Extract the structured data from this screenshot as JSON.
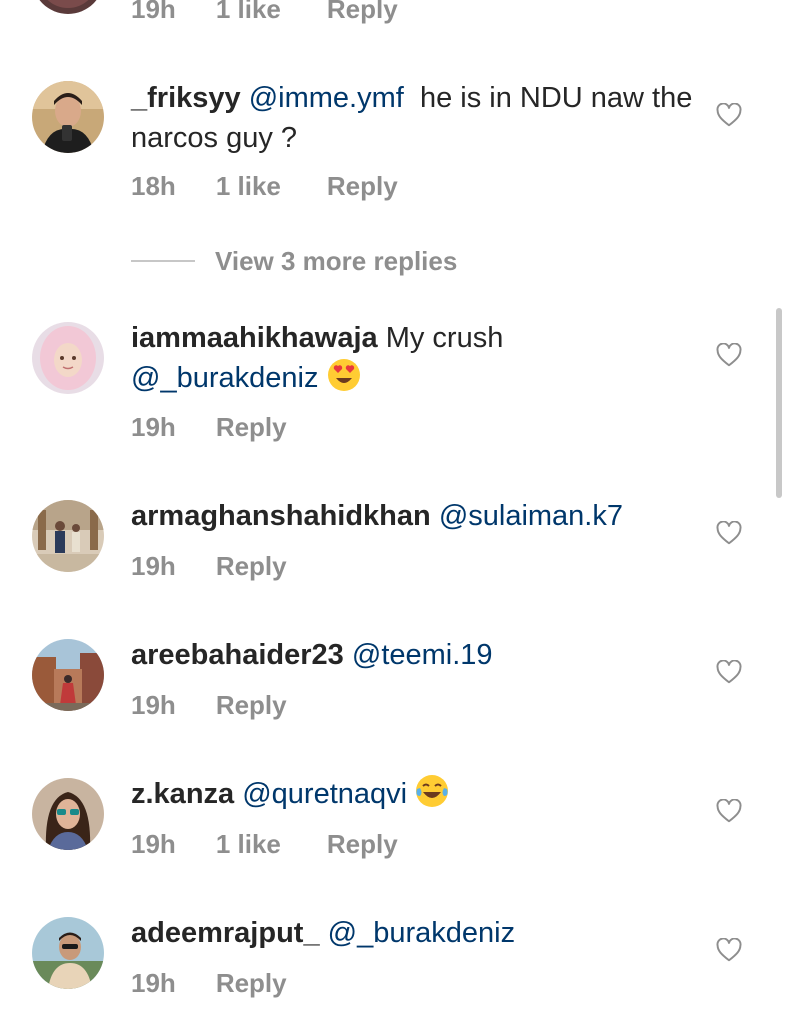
{
  "top_partial": {
    "time": "19h",
    "likes": "1 like",
    "reply": "Reply"
  },
  "comments": [
    {
      "username": "_friksyy",
      "mention": "@imme.ymf",
      "text": "he is in NDU naw the narcos guy ?",
      "time": "18h",
      "likes": "1 like",
      "reply": "Reply"
    },
    {
      "username": "iammaahikhawaja",
      "text": "My crush",
      "mention": "@_burakdeniz",
      "emoji": "heart-eyes-emoji",
      "time": "19h",
      "reply": "Reply"
    },
    {
      "username": "armaghanshahidkhan",
      "mention": "@sulaiman.k7",
      "time": "19h",
      "reply": "Reply"
    },
    {
      "username": "areebahaider23",
      "mention": "@teemi.19",
      "time": "19h",
      "reply": "Reply"
    },
    {
      "username": "z.kanza",
      "mention": "@quretnaqvi",
      "emoji": "tears-of-joy-emoji",
      "time": "19h",
      "likes": "1 like",
      "reply": "Reply"
    },
    {
      "username": "adeemrajput_",
      "mention": "@_burakdeniz",
      "time": "19h",
      "reply": "Reply"
    }
  ],
  "view_more_replies": "View 3 more replies",
  "icons": {
    "like": "heart-outline-icon"
  },
  "colors": {
    "text": "#262626",
    "secondary": "#8e8e8e",
    "mention": "#00376b",
    "emoji": "#ffcc33"
  }
}
